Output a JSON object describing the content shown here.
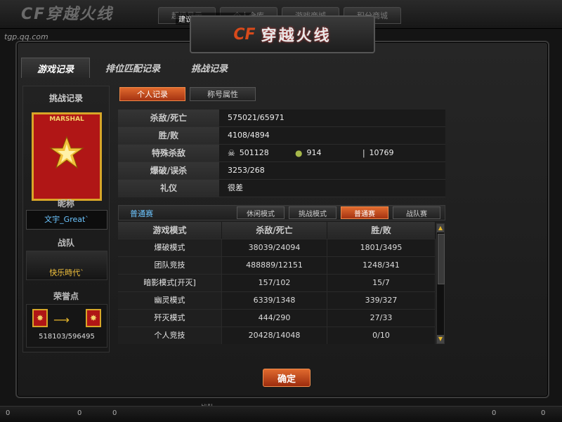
{
  "background": {
    "logo": "CF穿越火线",
    "url": "tgp.qq.com",
    "tabs": [
      "超级显示",
      "个人仓库",
      "游戏商城",
      "积分商城"
    ],
    "notice": "建议未成年人不要进入"
  },
  "logo": {
    "mark": "CF",
    "text": "穿越火线"
  },
  "main_tabs": [
    "游戏记录",
    "排位匹配记录",
    "挑战记录"
  ],
  "left": {
    "title": "挑战记录",
    "rank_label": "MARSHAL",
    "nickname_label": "昵称",
    "nickname": "文宇_Great`",
    "team_label": "战队",
    "team_name": "快乐時代`",
    "honor_label": "荣誉点",
    "honor_value": "518103/596495"
  },
  "sub_tabs": [
    "个人记录",
    "称号属性"
  ],
  "stats": [
    {
      "label": "杀敌/死亡",
      "value": "575021/65971"
    },
    {
      "label": "胜/败",
      "value": "4108/4894"
    },
    {
      "label": "特殊杀敌",
      "value": ""
    },
    {
      "label": "爆破/误杀",
      "value": "3253/268"
    },
    {
      "label": "礼仪",
      "value": "很差"
    }
  ],
  "special_kills": [
    {
      "icon": "skull-icon",
      "value": "501128"
    },
    {
      "icon": "grenade-icon",
      "value": "914"
    },
    {
      "icon": "knife-icon",
      "value": "10769"
    }
  ],
  "mode_bar": {
    "label": "普通赛",
    "buttons": [
      "休闲模式",
      "挑战模式",
      "普通赛",
      "战队赛"
    ]
  },
  "table": {
    "headers": [
      "游戏模式",
      "杀敌/死亡",
      "胜/败"
    ],
    "rows": [
      [
        "爆破模式",
        "38039/24094",
        "1801/3495"
      ],
      [
        "团队竞技",
        "488889/12151",
        "1248/341"
      ],
      [
        "暗影模式[开灭]",
        "157/102",
        "15/7"
      ],
      [
        "幽灵模式",
        "6339/1348",
        "339/327"
      ],
      [
        "歼灭模式",
        "444/290",
        "27/33"
      ],
      [
        "个人竞技",
        "20428/14048",
        "0/10"
      ]
    ]
  },
  "confirm": "确定",
  "bottom": {
    "left_counts": [
      "0",
      "0",
      "0"
    ],
    "mid": "战队",
    "right_counts": [
      "0",
      "0"
    ]
  }
}
